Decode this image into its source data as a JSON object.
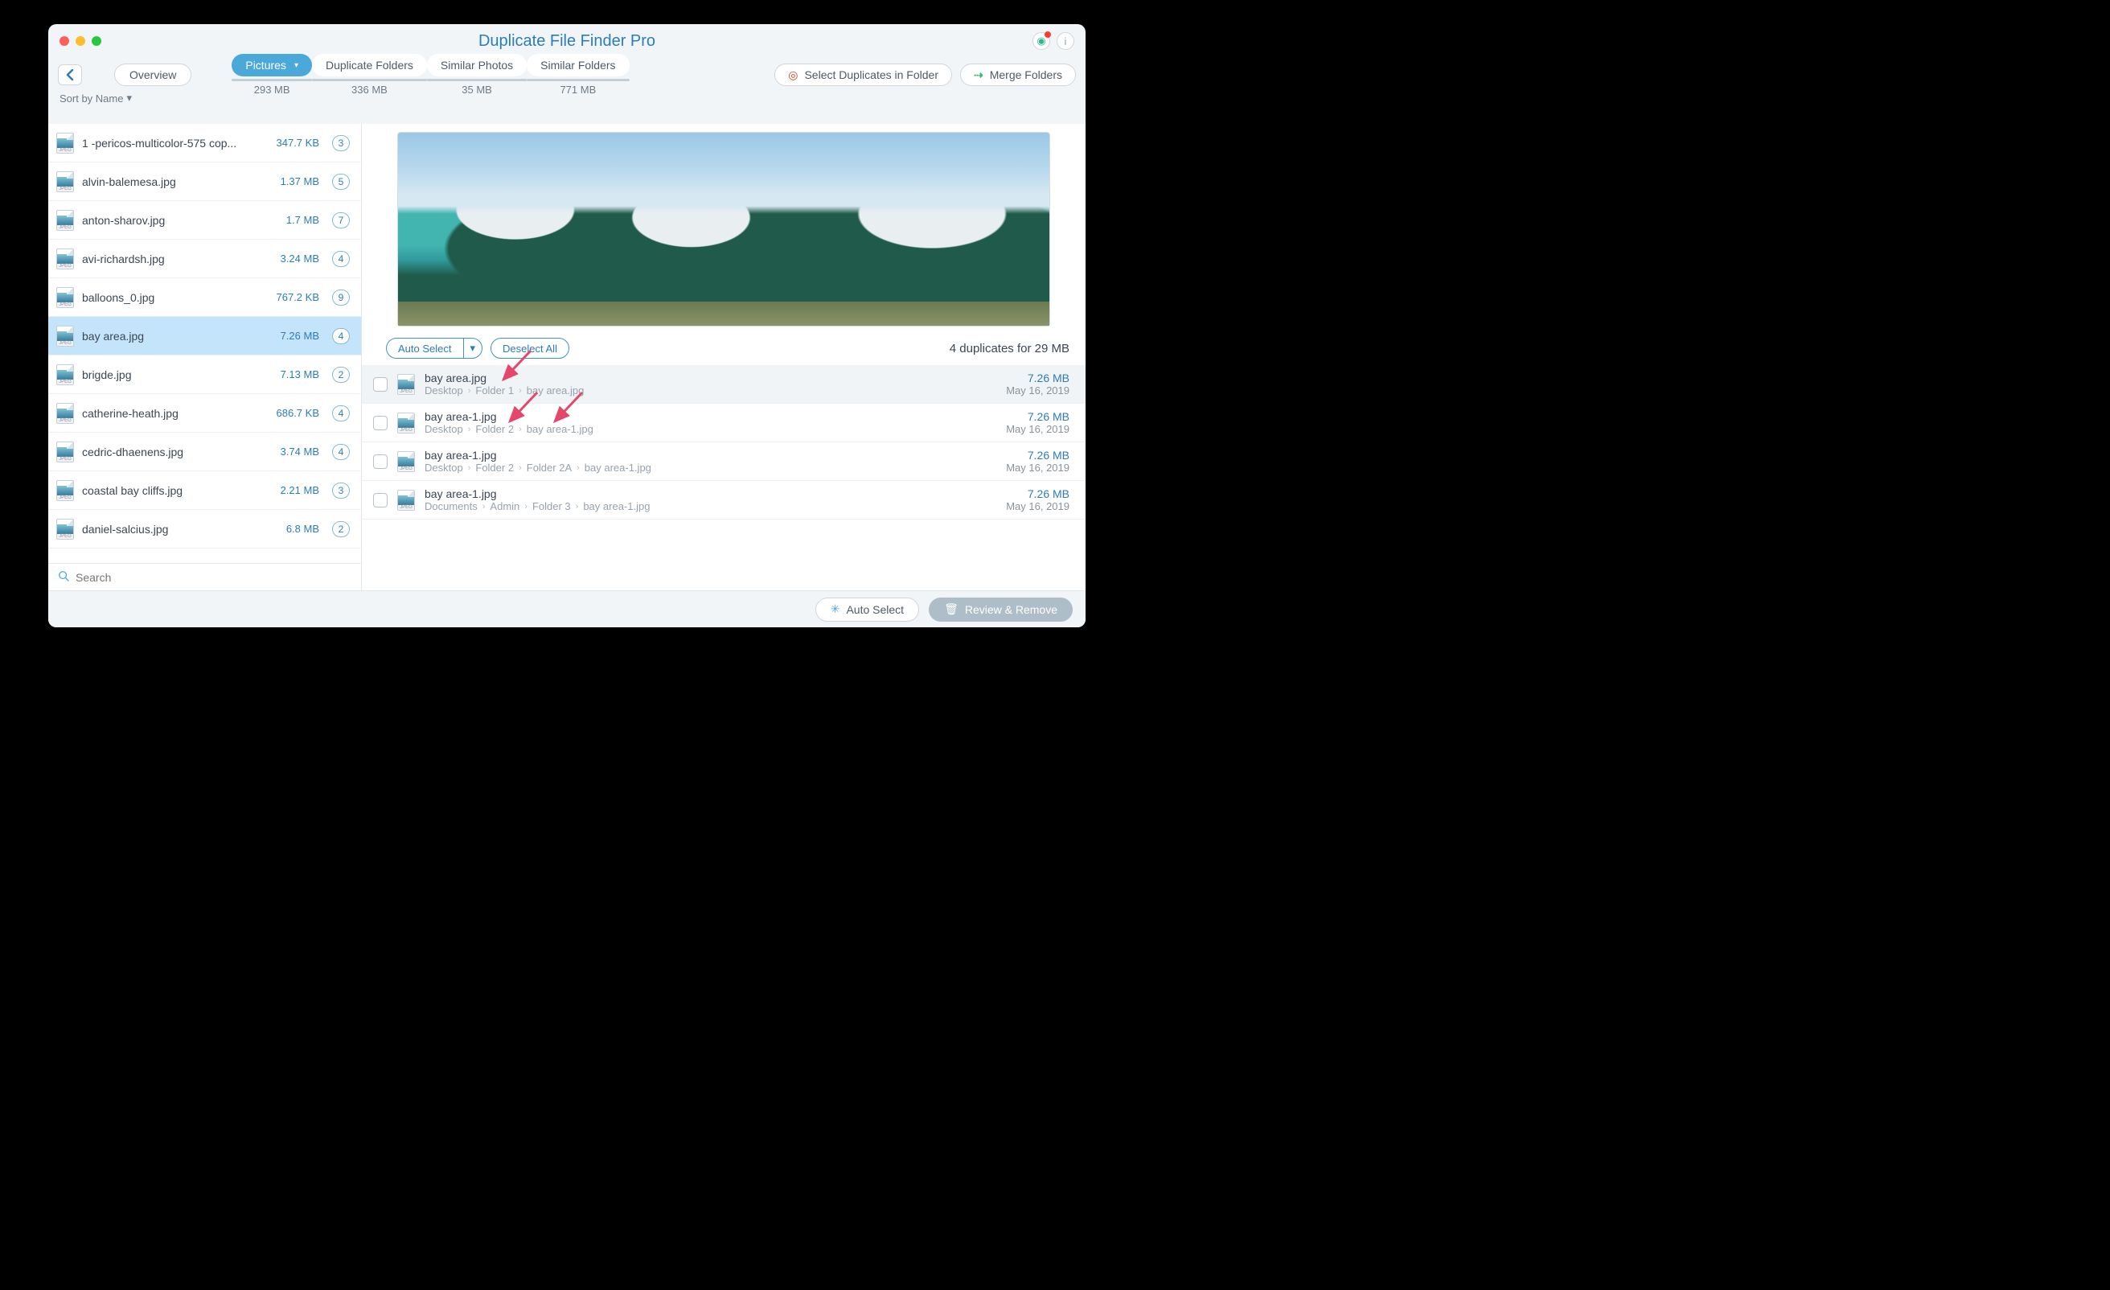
{
  "window_title": "Duplicate File Finder Pro",
  "back_button_label": "‹",
  "overview_button": "Overview",
  "tabs": [
    {
      "label": "Pictures",
      "size": "293 MB",
      "active": true,
      "dropdown": true
    },
    {
      "label": "Duplicate Folders",
      "size": "336 MB",
      "active": false
    },
    {
      "label": "Similar Photos",
      "size": "35 MB",
      "active": false
    },
    {
      "label": "Similar Folders",
      "size": "771 MB",
      "active": false
    }
  ],
  "actions": {
    "select_in_folder": "Select Duplicates in Folder",
    "merge_folders": "Merge Folders"
  },
  "sort_label": "Sort by Name",
  "sidebar_items": [
    {
      "name": "1 -pericos-multicolor-575 cop...",
      "size": "347.7 KB",
      "count": "3",
      "selected": false
    },
    {
      "name": "alvin-balemesa.jpg",
      "size": "1.37 MB",
      "count": "5",
      "selected": false
    },
    {
      "name": "anton-sharov.jpg",
      "size": "1.7 MB",
      "count": "7",
      "selected": false
    },
    {
      "name": "avi-richardsh.jpg",
      "size": "3.24 MB",
      "count": "4",
      "selected": false
    },
    {
      "name": "balloons_0.jpg",
      "size": "767.2 KB",
      "count": "9",
      "selected": false
    },
    {
      "name": "bay area.jpg",
      "size": "7.26 MB",
      "count": "4",
      "selected": true
    },
    {
      "name": "brigde.jpg",
      "size": "7.13 MB",
      "count": "2",
      "selected": false
    },
    {
      "name": "catherine-heath.jpg",
      "size": "686.7 KB",
      "count": "4",
      "selected": false
    },
    {
      "name": "cedric-dhaenens.jpg",
      "size": "3.74 MB",
      "count": "4",
      "selected": false
    },
    {
      "name": "coastal bay cliffs.jpg",
      "size": "2.21 MB",
      "count": "3",
      "selected": false
    },
    {
      "name": "daniel-salcius.jpg",
      "size": "6.8 MB",
      "count": "2",
      "selected": false
    }
  ],
  "search_placeholder": "Search",
  "dup_toolbar": {
    "auto_select": "Auto Select",
    "deselect_all": "Deselect All"
  },
  "dup_summary": "4 duplicates for 29 MB",
  "duplicates": [
    {
      "name": "bay area.jpg",
      "path": [
        "Desktop",
        "Folder 1",
        "bay area.jpg"
      ],
      "size": "7.26 MB",
      "date": "May 16, 2019",
      "selected": true
    },
    {
      "name": "bay area-1.jpg",
      "path": [
        "Desktop",
        "Folder 2",
        "bay area-1.jpg"
      ],
      "size": "7.26 MB",
      "date": "May 16, 2019",
      "selected": false
    },
    {
      "name": "bay area-1.jpg",
      "path": [
        "Desktop",
        "Folder 2",
        "Folder 2A",
        "bay area-1.jpg"
      ],
      "size": "7.26 MB",
      "date": "May 16, 2019",
      "selected": false
    },
    {
      "name": "bay area-1.jpg",
      "path": [
        "Documents",
        "Admin",
        "Folder 3",
        "bay area-1.jpg"
      ],
      "size": "7.26 MB",
      "date": "May 16, 2019",
      "selected": false
    }
  ],
  "footer": {
    "auto_select": "Auto Select",
    "review_remove": "Review & Remove"
  },
  "icons": {
    "jpeg_label": "JPEG",
    "chevron": "▾",
    "path_sep": "›",
    "search": "🔍",
    "target": "◎",
    "merge": "⇢",
    "wand": "✳",
    "trash": "🗑",
    "info": "i"
  }
}
